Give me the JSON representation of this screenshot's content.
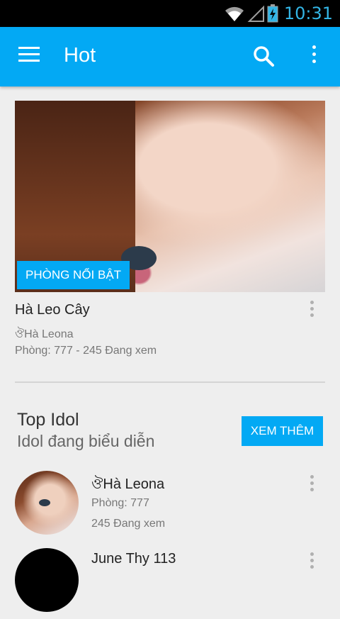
{
  "status_bar": {
    "time": "10:31",
    "icons": [
      "wifi-icon",
      "signal-icon",
      "battery-charging-icon"
    ]
  },
  "app_bar": {
    "title": "Hot",
    "actions": [
      "menu-icon",
      "search-icon",
      "more-vert-icon"
    ]
  },
  "featured": {
    "badge": "PHÒNG NỔI BẬT",
    "room_name": "Hà Leo Cây",
    "idol_name": "ঔHà Leona",
    "meta": "Phòng: 777 - 245 Đang xem"
  },
  "top_idol": {
    "title": "Top Idol",
    "subtitle": "Idol đang biểu diễn",
    "more_label": "XEM THÊM",
    "items": [
      {
        "name": "ঔHà Leona",
        "room": "Phòng: 777",
        "viewers": "245 Đang xem"
      },
      {
        "name": "June Thy 113"
      }
    ]
  },
  "colors": {
    "accent": "#03a9f4",
    "status_time": "#33b5e5",
    "background": "#eeeeee"
  }
}
